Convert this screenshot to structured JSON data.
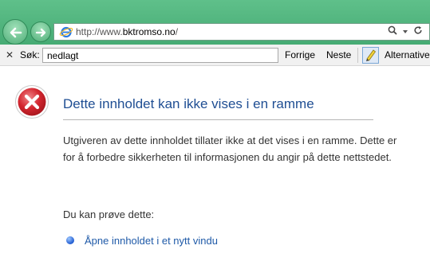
{
  "browser": {
    "address_bar": {
      "url_prefix": "http://www.",
      "url_host": "bktromso.no",
      "url_suffix": "/",
      "icons": [
        "ie-icon",
        "search-icon",
        "dropdown-icon",
        "refresh-icon"
      ]
    },
    "nav": {
      "icons": [
        "back-arrow-icon",
        "forward-arrow-icon"
      ]
    }
  },
  "findbar": {
    "close_glyph": "✕",
    "label": "Søk:",
    "value": "nedlagt",
    "prev_label": "Forrige",
    "next_label": "Neste",
    "highlight_icon": "highlighter-icon",
    "alt_label": "Alternativer"
  },
  "error_page": {
    "icon": "error-x-icon",
    "title": "Dette innholdet kan ikke vises i en ramme",
    "description": "Utgiveren av dette innholdet tillater ikke at det vises i en ramme. Dette er for å forbedre sikkerheten til informasjonen du angir på dette nettstedet.",
    "try_label": "Du kan prøve dette:",
    "link_label": "Åpne innholdet i et nytt vindu"
  },
  "colors": {
    "chrome_green": "#4fb57e",
    "title_blue": "#1f4e93",
    "link_blue": "#1f5aa8",
    "error_red": "#c8232b"
  }
}
